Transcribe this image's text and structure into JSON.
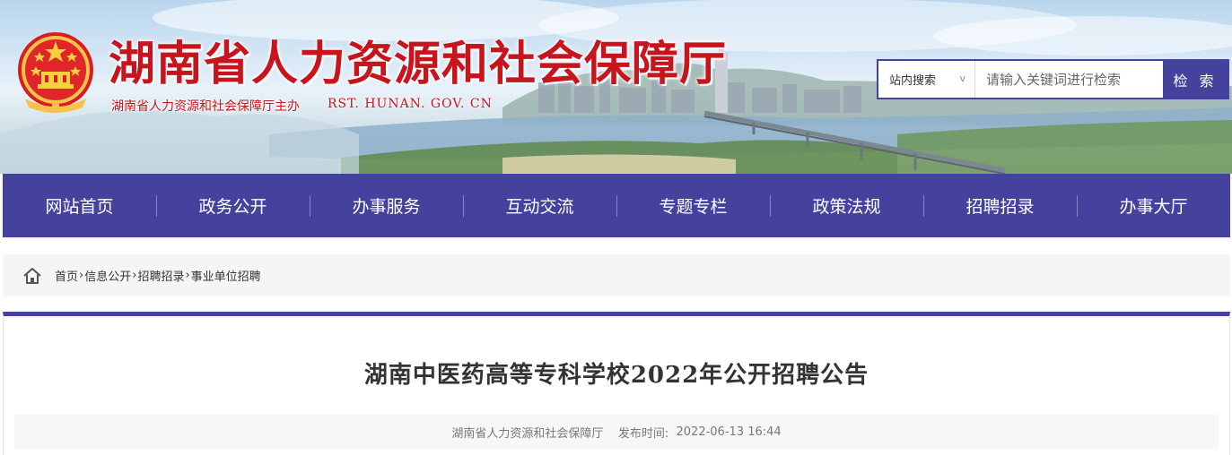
{
  "header": {
    "site_title": "湖南省人力资源和社会保障厅",
    "subtitle": "湖南省人力资源和社会保障厅主办",
    "domain": "RST. HUNAN. GOV. CN",
    "emblem_icon": "national-emblem-icon"
  },
  "search": {
    "scope_label": "站内搜索",
    "scope_chevron": "v",
    "placeholder": "请输入关键词进行检索",
    "value": "",
    "button_label": "检 索"
  },
  "nav": {
    "items": [
      {
        "label": "网站首页"
      },
      {
        "label": "政务公开"
      },
      {
        "label": "办事服务"
      },
      {
        "label": "互动交流"
      },
      {
        "label": "专题专栏"
      },
      {
        "label": "政策法规"
      },
      {
        "label": "招聘招录"
      },
      {
        "label": "办事大厅"
      }
    ]
  },
  "breadcrumb": {
    "home_icon": "home-icon",
    "items": [
      "首页",
      "信息公开",
      "招聘招录",
      "事业单位招聘"
    ],
    "separator": "›"
  },
  "article": {
    "title": "湖南中医药高等专科学校2022年公开招聘公告",
    "source": "湖南省人力资源和社会保障厅",
    "publish_label": "发布时间:",
    "publish_time": "2022-06-13 16:44"
  },
  "colors": {
    "brand": "#44429c",
    "title_red": "#c8141c"
  }
}
